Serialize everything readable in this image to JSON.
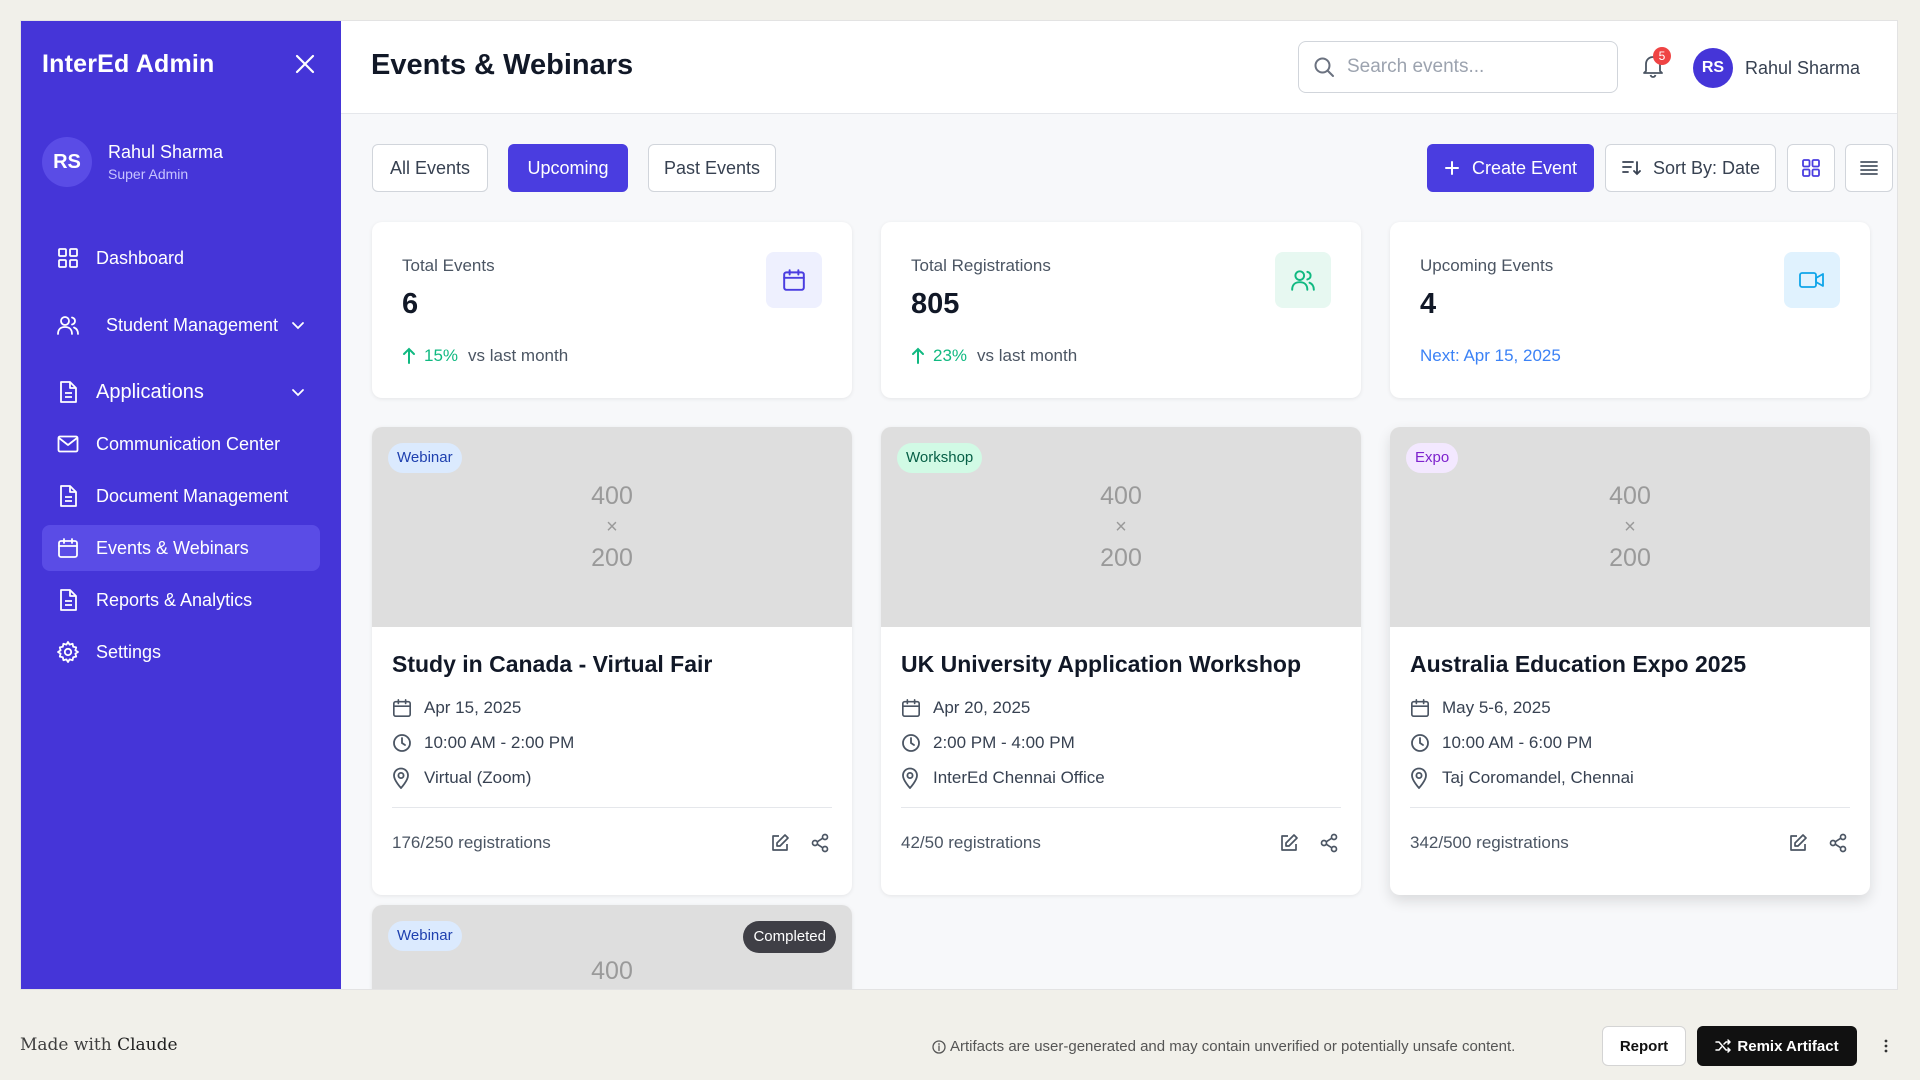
{
  "sidebar": {
    "brand": "InterEd Admin",
    "user": {
      "initials": "RS",
      "name": "Rahul Sharma",
      "role": "Super Admin"
    },
    "items": [
      {
        "label": "Dashboard",
        "icon": "grid-icon"
      },
      {
        "label": "Student Management",
        "icon": "users-icon"
      },
      {
        "label": "Applications",
        "icon": "file-icon"
      },
      {
        "label": "Communication Center",
        "icon": "mail-icon"
      },
      {
        "label": "Document Management",
        "icon": "file-icon"
      },
      {
        "label": "Events & Webinars",
        "icon": "calendar-icon"
      },
      {
        "label": "Reports & Analytics",
        "icon": "file-icon"
      },
      {
        "label": "Settings",
        "icon": "gear-icon"
      }
    ]
  },
  "header": {
    "title": "Events & Webinars",
    "search_placeholder": "Search events...",
    "notification_count": "5",
    "user": {
      "initials": "RS",
      "name": "Rahul Sharma"
    }
  },
  "toolbar": {
    "tabs": [
      "All Events",
      "Upcoming",
      "Past Events"
    ],
    "active_tab": "Upcoming",
    "create_label": "Create Event",
    "sort_label": "Sort By: Date"
  },
  "stats": [
    {
      "label": "Total Events",
      "value": "6",
      "change": "15%",
      "suffix": "vs last month",
      "icon": "calendar-icon",
      "accent": "#4a3de0"
    },
    {
      "label": "Total Registrations",
      "value": "805",
      "change": "23%",
      "suffix": "vs last month",
      "icon": "users-icon",
      "accent": "#10b981"
    },
    {
      "label": "Upcoming Events",
      "value": "4",
      "note": "Next: Apr 15, 2025",
      "icon": "video-icon",
      "accent": "#0ea5e9"
    }
  ],
  "events": [
    {
      "tag": "Webinar",
      "title": "Study in Canada - Virtual Fair",
      "date": "Apr 15, 2025",
      "time": "10:00 AM - 2:00 PM",
      "location": "Virtual (Zoom)",
      "registrations": "176/250 registrations",
      "placeholder": [
        "400",
        "×",
        "200"
      ]
    },
    {
      "tag": "Workshop",
      "title": "UK University Application Workshop",
      "date": "Apr 20, 2025",
      "time": "2:00 PM - 4:00 PM",
      "location": "InterEd Chennai Office",
      "registrations": "42/50 registrations",
      "placeholder": [
        "400",
        "×",
        "200"
      ]
    },
    {
      "tag": "Expo",
      "title": "Australia Education Expo 2025",
      "date": "May 5-6, 2025",
      "time": "10:00 AM - 6:00 PM",
      "location": "Taj Coromandel, Chennai",
      "registrations": "342/500 registrations",
      "placeholder": [
        "400",
        "×",
        "200"
      ]
    },
    {
      "tag": "Webinar",
      "status": "Completed",
      "placeholder": [
        "400"
      ]
    }
  ],
  "bottom": {
    "made_with": "Made with",
    "made_brand": "Claude",
    "disclaimer": "Artifacts are user-generated and may contain unverified or potentially unsafe content.",
    "report": "Report",
    "remix": "Remix Artifact"
  }
}
